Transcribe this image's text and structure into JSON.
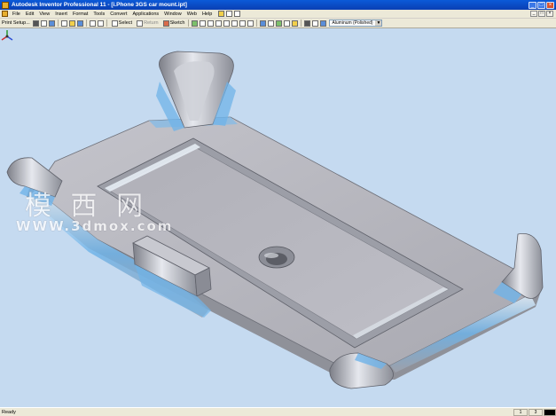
{
  "window": {
    "title": "Autodesk Inventor Professional 11 - [i.Phone 3GS car mount.ipt]"
  },
  "menu": {
    "items": [
      "File",
      "Edit",
      "View",
      "Insert",
      "Format",
      "Tools",
      "Convert",
      "Applications",
      "Window",
      "Web",
      "Help"
    ]
  },
  "toolbar": {
    "print_setup": "Print Setup...",
    "select_label": "Select",
    "return_label": "Return",
    "sketch_label": "Sketch",
    "material_value": "Aluminum (Polished)"
  },
  "watermark": {
    "chinese": "模 西 网",
    "url": "WWW.3dmox.com"
  },
  "status": {
    "text": "Ready",
    "cells": [
      "1",
      "3"
    ]
  },
  "colors": {
    "titlebar": "#0a4fcd",
    "viewport": "#c5daf0",
    "part_face": "#b7b7be",
    "edge_highlight": "#6fb3e8"
  }
}
